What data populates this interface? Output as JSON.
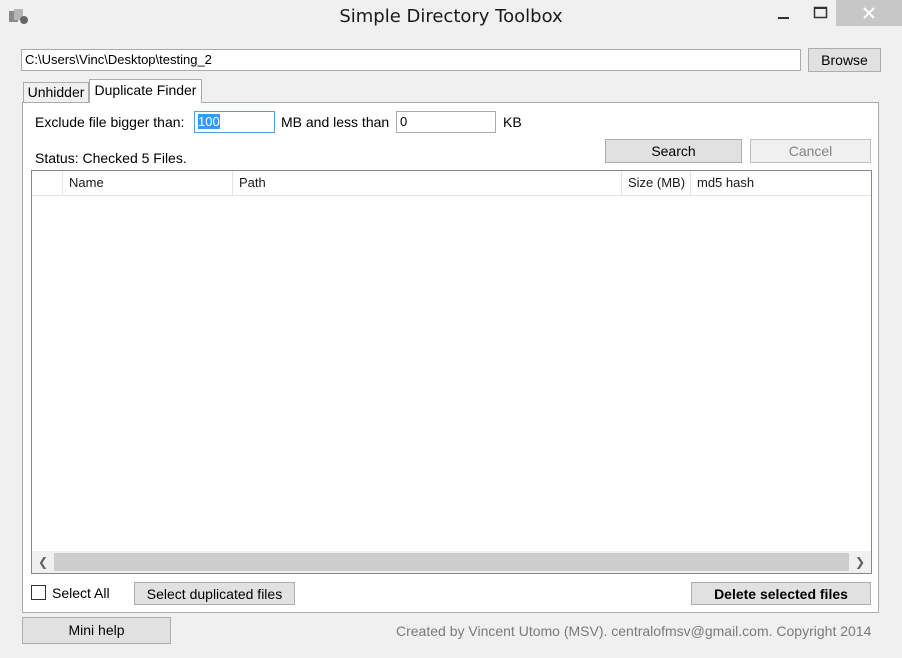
{
  "window": {
    "title": "Simple Directory Toolbox",
    "icon": "app-icon",
    "controls": {
      "minimize": "minimize-icon",
      "maximize": "maximize-icon",
      "close": "close-icon"
    }
  },
  "path_bar": {
    "value": "C:\\Users\\Vinc\\Desktop\\testing_2",
    "browse_label": "Browse"
  },
  "tabs": [
    {
      "label": "Unhidder",
      "selected": false
    },
    {
      "label": "Duplicate Finder",
      "selected": true
    }
  ],
  "filters": {
    "exclude_label": "Exclude file bigger than:",
    "max_value": "100",
    "mb_label": "MB and less than",
    "min_value": "0",
    "kb_label": "KB"
  },
  "status": "Status: Checked 5 Files.",
  "buttons": {
    "search": "Search",
    "cancel": "Cancel",
    "select_duplicated": "Select duplicated files",
    "delete_selected": "Delete selected files",
    "mini_help": "Mini help"
  },
  "list": {
    "columns": [
      "",
      "Name",
      "Path",
      "Size (MB)",
      "md5 hash"
    ],
    "rows": []
  },
  "select_all_label": "Select All",
  "footer": "Created by Vincent Utomo (MSV). centralofmsv@gmail.com. Copyright 2014"
}
